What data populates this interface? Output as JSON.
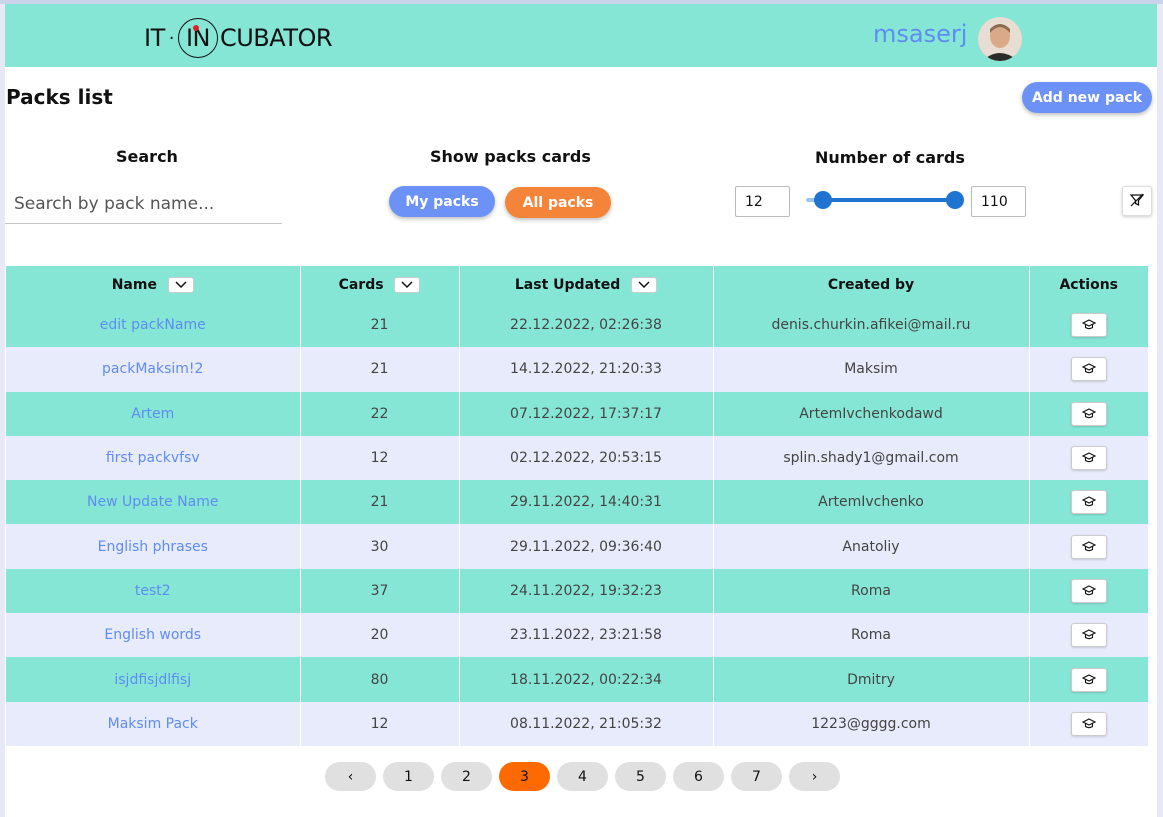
{
  "header": {
    "logo": {
      "left": "IT",
      "dot": "·",
      "circle": "IN",
      "right": "CUBATOR"
    },
    "username": "msaserj"
  },
  "page": {
    "title": "Packs list",
    "add_button": "Add new pack"
  },
  "filters": {
    "search_label": "Search",
    "search_placeholder": "Search by pack name...",
    "show_label": "Show packs cards",
    "my_packs": "My packs",
    "all_packs": "All packs",
    "number_label": "Number of cards",
    "min": "12",
    "max": "110",
    "range_min_fraction": 0.0,
    "range_max_fraction": 1.0
  },
  "table": {
    "columns": [
      "Name",
      "Cards",
      "Last Updated",
      "Created by",
      "Actions"
    ],
    "rows": [
      {
        "name": "edit packName",
        "cards": "21",
        "updated": "22.12.2022, 02:26:38",
        "created_by": "denis.churkin.afikei@mail.ru"
      },
      {
        "name": "packMaksim!2",
        "cards": "21",
        "updated": "14.12.2022, 21:20:33",
        "created_by": "Maksim"
      },
      {
        "name": "Artem",
        "cards": "22",
        "updated": "07.12.2022, 17:37:17",
        "created_by": "ArtemIvchenkodawd"
      },
      {
        "name": "first packvfsv",
        "cards": "12",
        "updated": "02.12.2022, 20:53:15",
        "created_by": "splin.shady1@gmail.com"
      },
      {
        "name": "New Update Name",
        "cards": "21",
        "updated": "29.11.2022, 14:40:31",
        "created_by": "ArtemIvchenko"
      },
      {
        "name": "English phrases",
        "cards": "30",
        "updated": "29.11.2022, 09:36:40",
        "created_by": "Anatoliy"
      },
      {
        "name": "test2",
        "cards": "37",
        "updated": "24.11.2022, 19:32:23",
        "created_by": "Roma"
      },
      {
        "name": "English words",
        "cards": "20",
        "updated": "23.11.2022, 23:21:58",
        "created_by": "Roma"
      },
      {
        "name": "isjdfisjdlfisj",
        "cards": "80",
        "updated": "18.11.2022, 00:22:34",
        "created_by": "Dmitry"
      },
      {
        "name": "Maksim Pack",
        "cards": "12",
        "updated": "08.11.2022, 21:05:32",
        "created_by": "1223@gggg.com"
      }
    ]
  },
  "pagination": {
    "prev": "‹",
    "next": "›",
    "pages": [
      "1",
      "2",
      "3",
      "4",
      "5",
      "6",
      "7"
    ],
    "current": "3"
  },
  "colors": {
    "header_bg": "#86e6d6",
    "accent_blue": "#6d92f7",
    "accent_orange": "#f5843b",
    "active_page": "#ff6a00"
  },
  "icons": {
    "filter": "filter-off-icon",
    "sort": "chevron-down-icon",
    "learn": "graduation-cap-icon"
  }
}
